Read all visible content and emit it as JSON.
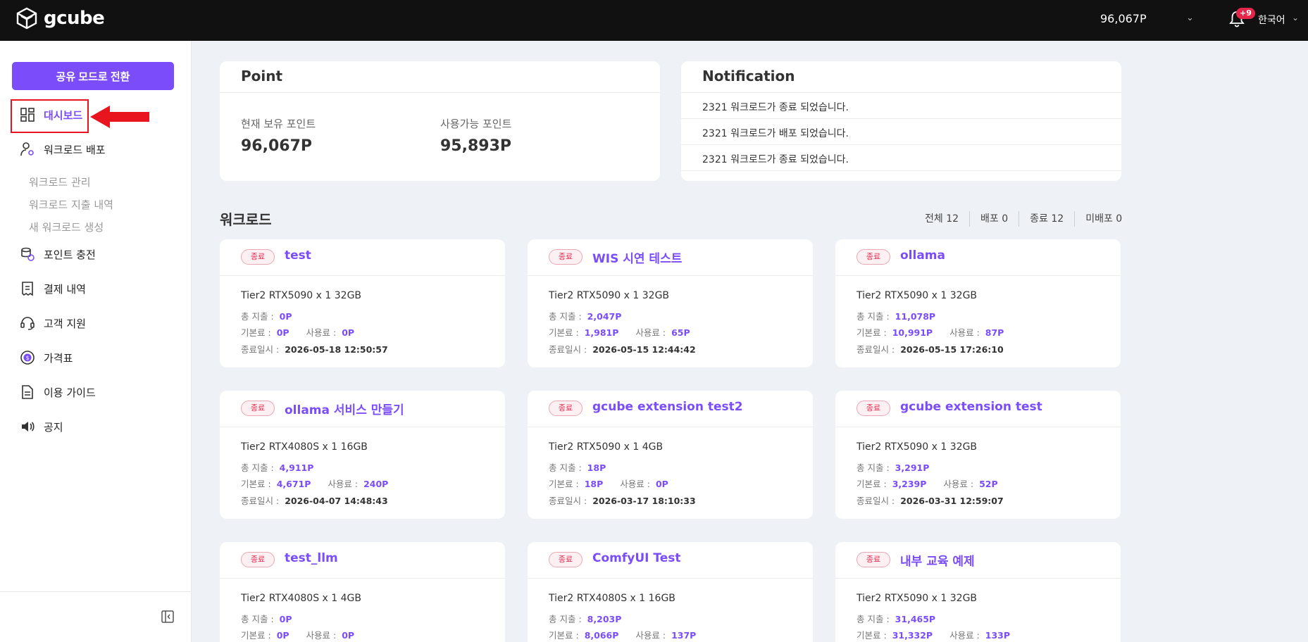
{
  "header": {
    "brand": "gcube",
    "points": "96,067P",
    "notification_badge": "+9",
    "language": "한국어"
  },
  "sidebar": {
    "share_button": "공유 모드로 전환",
    "items": [
      {
        "label": "대시보드",
        "icon": "dashboard-icon",
        "active": true
      },
      {
        "label": "워크로드 배포",
        "icon": "user-gear-icon"
      },
      {
        "label": "포인트 충전",
        "icon": "coin-stack-icon"
      },
      {
        "label": "결제 내역",
        "icon": "receipt-icon"
      },
      {
        "label": "고객 지원",
        "icon": "headset-icon"
      },
      {
        "label": "가격표",
        "icon": "price-coin-icon"
      },
      {
        "label": "이용 가이드",
        "icon": "document-icon"
      },
      {
        "label": "공지",
        "icon": "speaker-icon"
      }
    ],
    "sub_items": [
      "워크로드 관리",
      "워크로드 지출 내역",
      "새 워크로드 생성"
    ]
  },
  "point": {
    "title": "Point",
    "current_label": "현재 보유 포인트",
    "current_value": "96,067P",
    "available_label": "사용가능 포인트",
    "available_value": "95,893P"
  },
  "notification": {
    "title": "Notification",
    "items": [
      "2321 워크로드가 종료 되었습니다.",
      "2321 워크로드가 배포 되었습니다.",
      "2321 워크로드가 종료 되었습니다."
    ]
  },
  "workloads": {
    "title": "워크로드",
    "filters": [
      "전체 12",
      "배포 0",
      "종료 12",
      "미배포 0"
    ],
    "labels": {
      "total": "총 지출 :",
      "base": "기본료 :",
      "usage": "사용료 :",
      "ended": "종료일시 :"
    },
    "cards": [
      {
        "status": "종료",
        "name": "test",
        "spec": "Tier2 RTX5090 x 1 32GB",
        "total": "0P",
        "base": "0P",
        "usage": "0P",
        "ended": "2026-05-18 12:50:57"
      },
      {
        "status": "종료",
        "name": "WIS 시연 테스트",
        "spec": "Tier2 RTX5090 x 1 32GB",
        "total": "2,047P",
        "base": "1,981P",
        "usage": "65P",
        "ended": "2026-05-15 12:44:42"
      },
      {
        "status": "종료",
        "name": "ollama",
        "spec": "Tier2 RTX5090 x 1 32GB",
        "total": "11,078P",
        "base": "10,991P",
        "usage": "87P",
        "ended": "2026-05-15 17:26:10"
      },
      {
        "status": "종료",
        "name": "ollama 서비스 만들기",
        "spec": "Tier2 RTX4080S x 1 16GB",
        "total": "4,911P",
        "base": "4,671P",
        "usage": "240P",
        "ended": "2026-04-07 14:48:43"
      },
      {
        "status": "종료",
        "name": "gcube extension test2",
        "spec": "Tier2 RTX5090 x 1 4GB",
        "total": "18P",
        "base": "18P",
        "usage": "0P",
        "ended": "2026-03-17 18:10:33"
      },
      {
        "status": "종료",
        "name": "gcube extension test",
        "spec": "Tier2 RTX5090 x 1 32GB",
        "total": "3,291P",
        "base": "3,239P",
        "usage": "52P",
        "ended": "2026-03-31 12:59:07"
      },
      {
        "status": "종료",
        "name": "test_llm",
        "spec": "Tier2 RTX4080S x 1 4GB",
        "total": "0P",
        "base": "0P",
        "usage": "0P",
        "ended": ""
      },
      {
        "status": "종료",
        "name": "ComfyUI Test",
        "spec": "Tier2 RTX4080S x 1 16GB",
        "total": "8,203P",
        "base": "8,066P",
        "usage": "137P",
        "ended": ""
      },
      {
        "status": "종료",
        "name": "내부 교육 예제",
        "spec": "Tier2 RTX5090 x 1 32GB",
        "total": "31,465P",
        "base": "31,332P",
        "usage": "133P",
        "ended": ""
      }
    ]
  },
  "colors": {
    "accent": "#7b4dfa",
    "header_bg": "#111111",
    "page_bg": "#eef1f5",
    "status_red": "#e5264b",
    "highlight_red": "#e8141e"
  }
}
